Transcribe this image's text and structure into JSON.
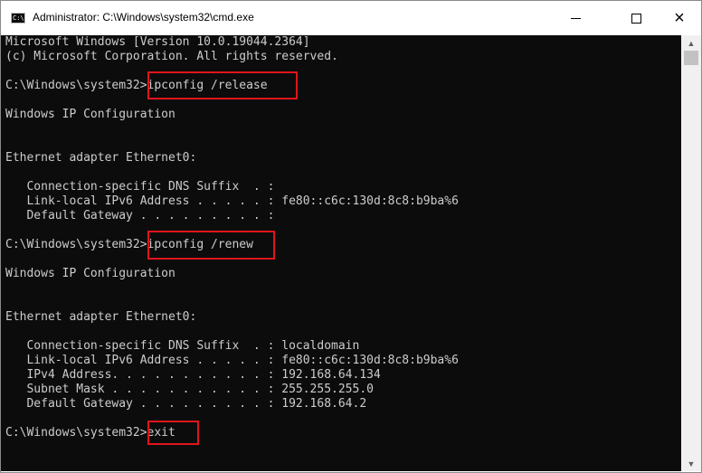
{
  "window": {
    "title": "Administrator: C:\\Windows\\system32\\cmd.exe",
    "icon_text": "C:\\",
    "controls": {
      "minimize": "minimize-icon",
      "maximize": "maximize-icon",
      "close": "×"
    }
  },
  "console": {
    "lines": [
      "Microsoft Windows [Version 10.0.19044.2364]",
      "(c) Microsoft Corporation. All rights reserved.",
      "",
      "C:\\Windows\\system32>ipconfig /release",
      "",
      "Windows IP Configuration",
      "",
      "",
      "Ethernet adapter Ethernet0:",
      "",
      "   Connection-specific DNS Suffix  . :",
      "   Link-local IPv6 Address . . . . . : fe80::c6c:130d:8c8:b9ba%6",
      "   Default Gateway . . . . . . . . . :",
      "",
      "C:\\Windows\\system32>ipconfig /renew",
      "",
      "Windows IP Configuration",
      "",
      "",
      "Ethernet adapter Ethernet0:",
      "",
      "   Connection-specific DNS Suffix  . : localdomain",
      "   Link-local IPv6 Address . . . . . : fe80::c6c:130d:8c8:b9ba%6",
      "   IPv4 Address. . . . . . . . . . . : 192.168.64.134",
      "   Subnet Mask . . . . . . . . . . . : 255.255.255.0",
      "   Default Gateway . . . . . . . . . : 192.168.64.2",
      "",
      "C:\\Windows\\system32>exit"
    ],
    "highlighted_commands": [
      "ipconfig /release",
      "ipconfig /renew",
      "exit"
    ],
    "highlight_color": "#e1141b",
    "background": "#0c0c0c",
    "text_color": "#cccccc"
  },
  "scrollbar": {
    "up": "▲",
    "down": "▼"
  }
}
